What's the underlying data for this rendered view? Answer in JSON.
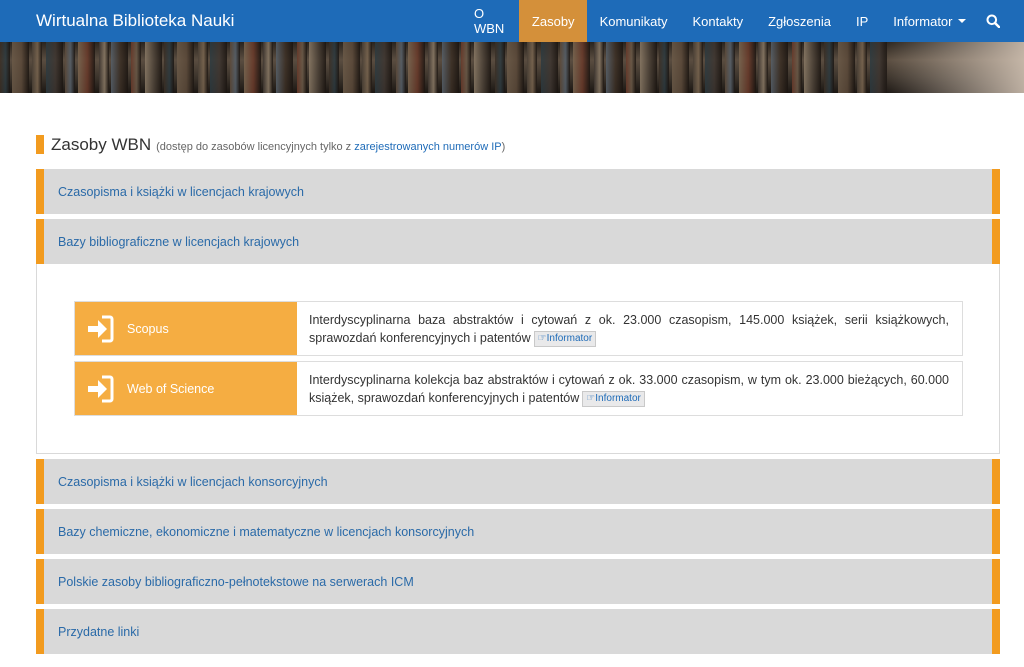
{
  "brand": "Wirtualna Biblioteka Nauki",
  "nav": [
    {
      "label": "O WBN"
    },
    {
      "label": "Zasoby"
    },
    {
      "label": "Komunikaty"
    },
    {
      "label": "Kontakty"
    },
    {
      "label": "Zgłoszenia"
    },
    {
      "label": "IP"
    },
    {
      "label": "Informator"
    }
  ],
  "main": {
    "title": "Zasoby WBN",
    "subtitle_before": "(dostęp do zasobów licencyjnych tylko z ",
    "subtitle_link": "zarejestrowanych numerów IP",
    "subtitle_after": ")"
  },
  "panels": [
    {
      "label": "Czasopisma i książki w licencjach krajowych"
    },
    {
      "label": "Bazy bibliograficzne w licencjach krajowych"
    },
    {
      "label": "Czasopisma i książki w licencjach konsorcyjnych"
    },
    {
      "label": "Bazy chemiczne, ekonomiczne i matematyczne w licencjach konsorcyjnych"
    },
    {
      "label": "Polskie zasoby bibliograficzno-pełnotekstowe na serwerach ICM"
    },
    {
      "label": "Przydatne linki"
    }
  ],
  "resources": [
    {
      "name": "Scopus",
      "description": "Interdyscyplinarna baza abstraktów i cytowań z ok. 23.000 czasopism, 145.000 książek, serii książkowych, sprawozdań konferencyjnych i patentów",
      "badge": "Informator"
    },
    {
      "name": "Web of Science",
      "description": "Interdyscyplinarna kolekcja baz abstraktów i cytowań z ok. 33.000 czasopism, w tym ok. 23.000 bieżących, 60.000 książek, sprawozdań konferencyjnych i patentów",
      "badge": "Informator"
    }
  ],
  "colors": {
    "navbar": "#1e6bb8",
    "active_nav": "#d4903a",
    "accent": "#f29b1f",
    "resource_tile": "#f5ad42",
    "panel": "#d9d9d9",
    "link": "#2a6aa8"
  },
  "icons": {
    "search": "search-icon",
    "dropdown": "caret-down-icon",
    "login": "sign-in-icon",
    "badge": "hand-point-right-icon"
  }
}
